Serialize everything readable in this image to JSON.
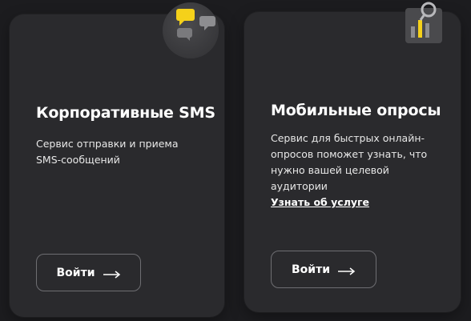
{
  "cards": [
    {
      "title": "Корпоративные SMS",
      "description": "Сервис отправки и приема SMS-сообщений",
      "button_label": "Войти",
      "icon": "chat-bubbles-icon"
    },
    {
      "title": "Мобильные опросы",
      "description": "Сервис для быстрых онлайн-опросов поможет узнать, что нужно вашей целевой аудитории",
      "link_label": "Узнать об услуге",
      "button_label": "Войти",
      "icon": "survey-chart-magnifier-icon"
    }
  ],
  "colors": {
    "background": "#1c1c1f",
    "card": "#2a2a2d",
    "accent": "#f5d11a",
    "text": "#ffffff",
    "button_border": "#6e6e72"
  }
}
